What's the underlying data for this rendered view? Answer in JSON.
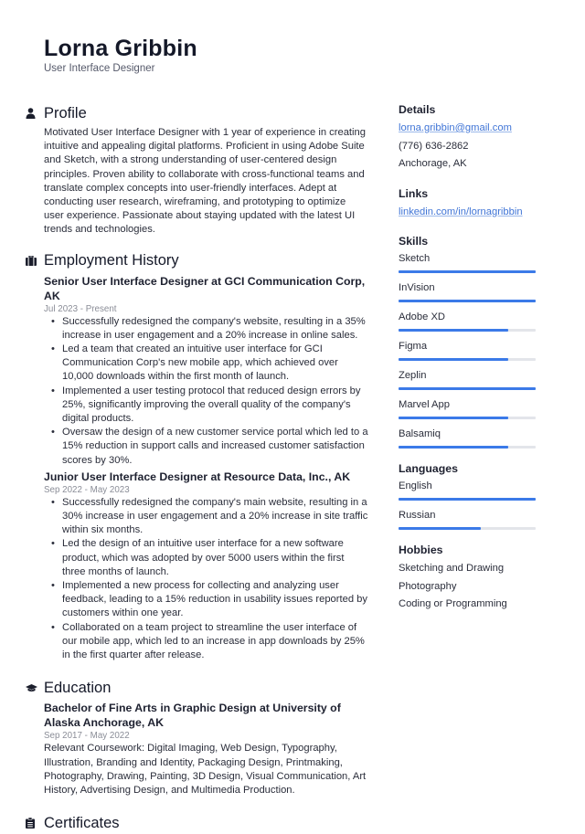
{
  "header": {
    "name": "Lorna Gribbin",
    "title": "User Interface Designer"
  },
  "profile": {
    "heading": "Profile",
    "icon": "person-icon",
    "text": "Motivated User Interface Designer with 1 year of experience in creating intuitive and appealing digital platforms. Proficient in using Adobe Suite and Sketch, with a strong understanding of user-centered design principles. Proven ability to collaborate with cross-functional teams and translate complex concepts into user-friendly interfaces. Adept at conducting user research, wireframing, and prototyping to optimize user experience. Passionate about staying updated with the latest UI trends and technologies."
  },
  "employment": {
    "heading": "Employment History",
    "icon": "briefcase-icon",
    "jobs": [
      {
        "title": "Senior User Interface Designer at GCI Communication Corp, AK",
        "dates": "Jul 2023 - Present",
        "bullets": [
          "Successfully redesigned the company's website, resulting in a 35% increase in user engagement and a 20% increase in online sales.",
          "Led a team that created an intuitive user interface for GCI Communication Corp's new mobile app, which achieved over 10,000 downloads within the first month of launch.",
          "Implemented a user testing protocol that reduced design errors by 25%, significantly improving the overall quality of the company's digital products.",
          "Oversaw the design of a new customer service portal which led to a 15% reduction in support calls and increased customer satisfaction scores by 30%."
        ]
      },
      {
        "title": "Junior User Interface Designer at Resource Data, Inc., AK",
        "dates": "Sep 2022 - May 2023",
        "bullets": [
          "Successfully redesigned the company's main website, resulting in a 30% increase in user engagement and a 20% increase in site traffic within six months.",
          "Led the design of an intuitive user interface for a new software product, which was adopted by over 5000 users within the first three months of launch.",
          "Implemented a new process for collecting and analyzing user feedback, leading to a 15% reduction in usability issues reported by customers within one year.",
          "Collaborated on a team project to streamline the user interface of our mobile app, which led to an increase in app downloads by 25% in the first quarter after release."
        ]
      }
    ]
  },
  "education": {
    "heading": "Education",
    "icon": "graduation-cap-icon",
    "degree": "Bachelor of Fine Arts in Graphic Design at University of Alaska Anchorage, AK",
    "dates": "Sep 2017 - May 2022",
    "text": "Relevant Coursework: Digital Imaging, Web Design, Typography, Illustration, Branding and Identity, Packaging Design, Printmaking, Photography, Drawing, Painting, 3D Design, Visual Communication, Art History, Advertising Design, and Multimedia Production."
  },
  "certificates": {
    "heading": "Certificates",
    "icon": "clipboard-icon"
  },
  "details": {
    "heading": "Details",
    "email": "lorna.gribbin@gmail.com",
    "phone": "(776) 636-2862",
    "location": "Anchorage, AK"
  },
  "links": {
    "heading": "Links",
    "items": [
      "linkedin.com/in/lornagribbin"
    ]
  },
  "skills": {
    "heading": "Skills",
    "items": [
      {
        "label": "Sketch",
        "level": 1.0
      },
      {
        "label": "InVision",
        "level": 1.0
      },
      {
        "label": "Adobe XD",
        "level": 0.8
      },
      {
        "label": "Figma",
        "level": 0.8
      },
      {
        "label": "Zeplin",
        "level": 1.0
      },
      {
        "label": "Marvel App",
        "level": 0.8
      },
      {
        "label": "Balsamiq",
        "level": 0.8
      }
    ]
  },
  "languages": {
    "heading": "Languages",
    "items": [
      {
        "label": "English",
        "level": 1.0
      },
      {
        "label": "Russian",
        "level": 0.6
      }
    ]
  },
  "hobbies": {
    "heading": "Hobbies",
    "items": [
      "Sketching and Drawing",
      "Photography",
      "Coding or Programming"
    ]
  },
  "colors": {
    "accent": "#3b7ae8",
    "link": "#3f74d6",
    "track": "#e3e5ea"
  }
}
